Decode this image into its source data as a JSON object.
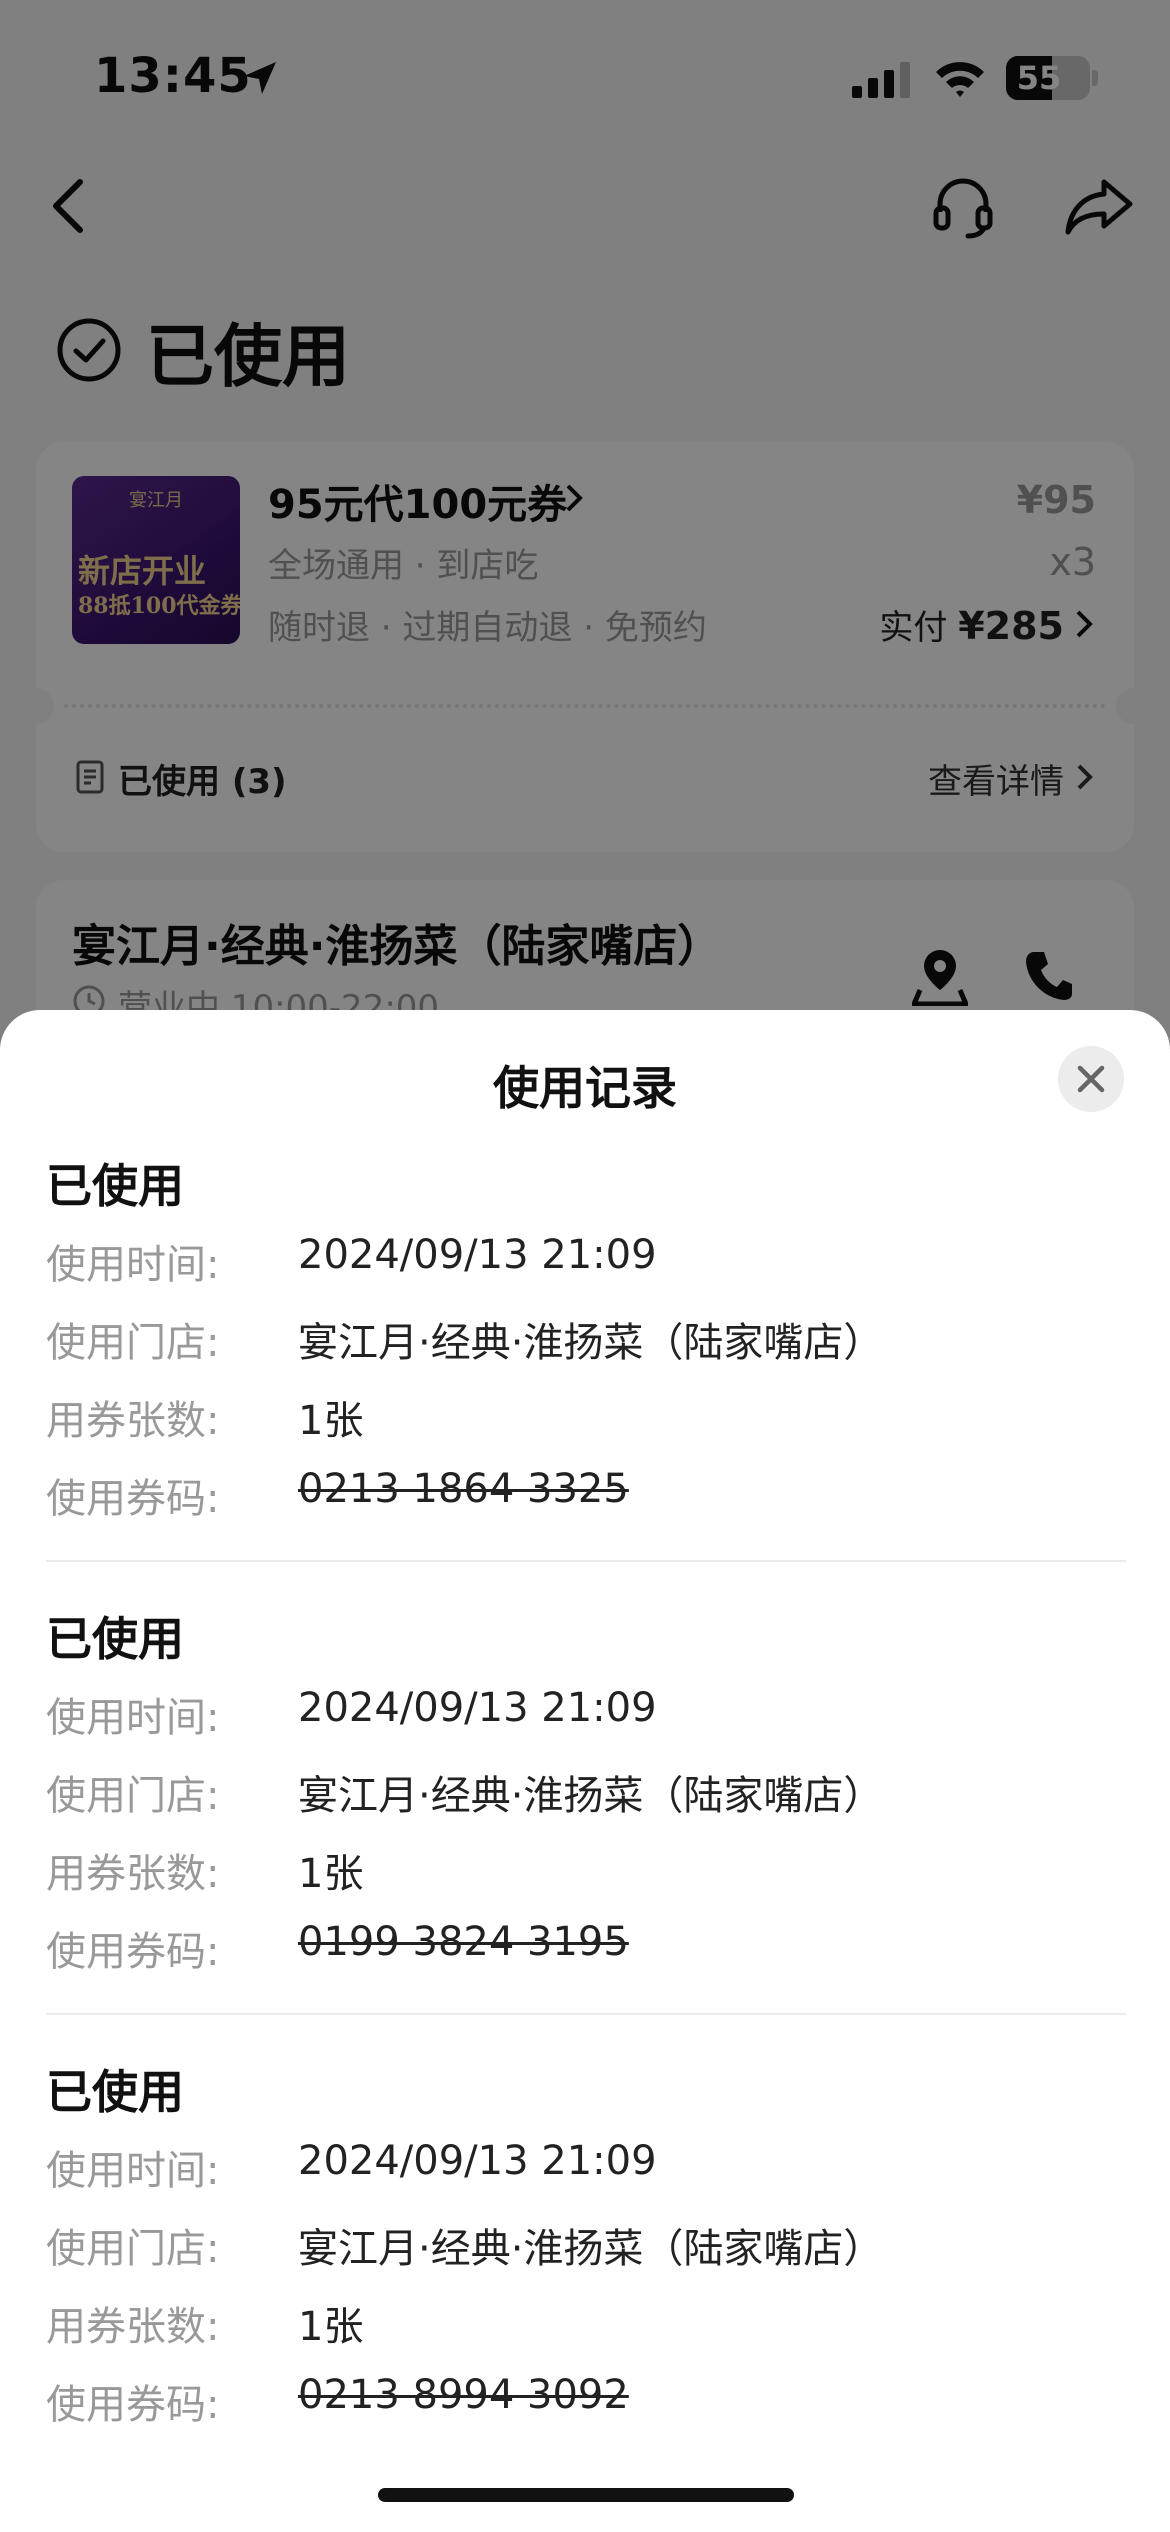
{
  "status_bar": {
    "time": "13:45",
    "battery": "55",
    "battery_level": 0.55
  },
  "header": {
    "status_title": "已使用"
  },
  "coupon_card": {
    "image_brand": "宴江月",
    "image_line1": "新店开业",
    "image_line2": "88抵100代金券",
    "title": "95元代100元券",
    "tags1": "全场通用 · 到店吃",
    "tags2": "随时退 · 过期自动退 · 免预约",
    "price": "¥95",
    "quantity": "x3",
    "paid_label": "实付 ",
    "paid_amount": "¥285",
    "used_label": "已使用 (3)",
    "detail_link": "查看详情"
  },
  "store": {
    "name": "宴江月·经典·淮扬菜（陆家嘴店）",
    "hours": "营业中 10:00-22:00"
  },
  "sheet": {
    "title": "使用记录",
    "labels": {
      "time": "使用时间:",
      "store": "使用门店:",
      "count": "用券张数:",
      "code": "使用券码:"
    },
    "records": [
      {
        "status": "已使用",
        "time": "2024/09/13 21:09",
        "store": "宴江月·经典·淮扬菜（陆家嘴店）",
        "count": "1张",
        "code": "0213 1864 3325"
      },
      {
        "status": "已使用",
        "time": "2024/09/13 21:09",
        "store": "宴江月·经典·淮扬菜（陆家嘴店）",
        "count": "1张",
        "code": "0199 3824 3195"
      },
      {
        "status": "已使用",
        "time": "2024/09/13 21:09",
        "store": "宴江月·经典·淮扬菜（陆家嘴店）",
        "count": "1张",
        "code": "0213 8994 3092"
      }
    ]
  },
  "icons": {
    "location": "location-arrow-icon",
    "signal": "cellular-signal-icon",
    "wifi": "wifi-icon",
    "back": "back-chevron-icon",
    "service": "headset-icon",
    "share": "share-icon",
    "check": "check-circle-icon",
    "receipt": "receipt-icon",
    "clock": "clock-icon",
    "navigate": "navigation-pin-icon",
    "phone": "phone-icon",
    "close": "close-icon"
  }
}
